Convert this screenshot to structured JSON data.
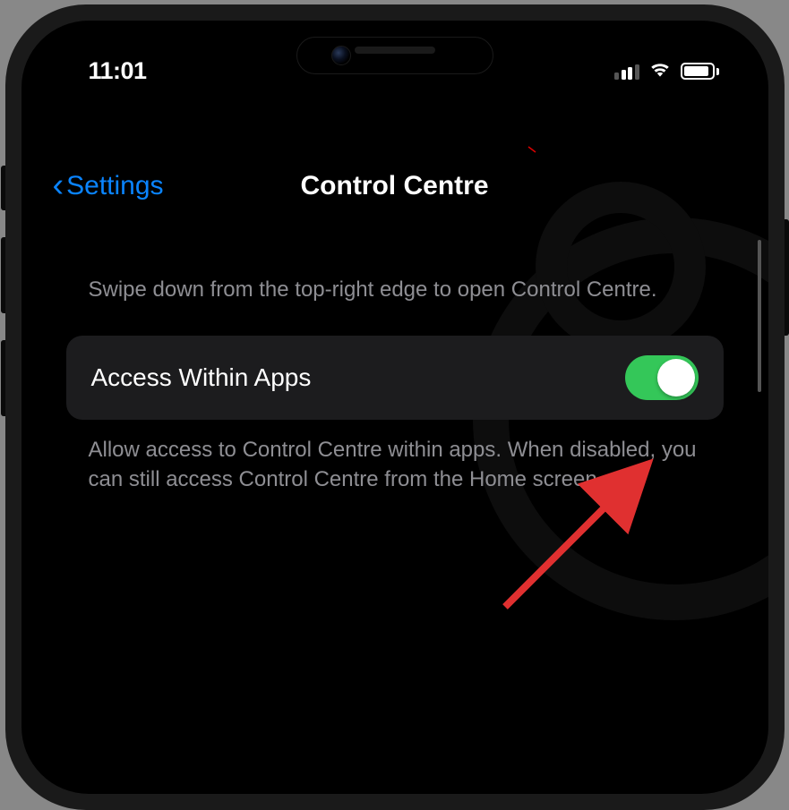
{
  "statusBar": {
    "time": "11:01"
  },
  "nav": {
    "backLabel": "Settings",
    "title": "Control Centre"
  },
  "section": {
    "header": "Swipe down from the top-right edge to open Control Centre.",
    "toggleLabel": "Access Within Apps",
    "toggleOn": true,
    "footer": "Allow access to Control Centre within apps. When disabled, you can still access Control Centre from the Home screen."
  }
}
